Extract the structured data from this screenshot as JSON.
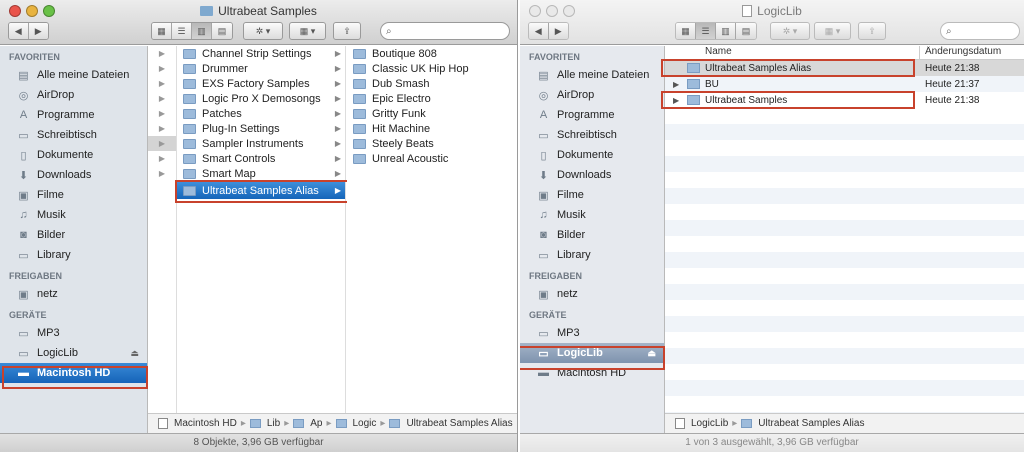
{
  "left": {
    "title": "Ultrabeat Samples",
    "search_placeholder": "",
    "sidebar": {
      "sections": [
        {
          "label": "FAVORITEN",
          "items": [
            {
              "label": "Alle meine Dateien",
              "icon": "all-files-icon"
            },
            {
              "label": "AirDrop",
              "icon": "airdrop-icon"
            },
            {
              "label": "Programme",
              "icon": "applications-icon"
            },
            {
              "label": "Schreibtisch",
              "icon": "desktop-icon"
            },
            {
              "label": "Dokumente",
              "icon": "documents-icon"
            },
            {
              "label": "Downloads",
              "icon": "downloads-icon"
            },
            {
              "label": "Filme",
              "icon": "movies-icon"
            },
            {
              "label": "Musik",
              "icon": "music-icon"
            },
            {
              "label": "Bilder",
              "icon": "pictures-icon"
            },
            {
              "label": "Library",
              "icon": "folder-icon"
            }
          ]
        },
        {
          "label": "FREIGABEN",
          "items": [
            {
              "label": "netz",
              "icon": "network-icon"
            }
          ]
        },
        {
          "label": "GERÄTE",
          "items": [
            {
              "label": "MP3",
              "icon": "disk-icon"
            },
            {
              "label": "LogicLib",
              "icon": "disk-icon"
            },
            {
              "label": "Macintosh HD",
              "icon": "hard-drive-icon"
            }
          ]
        }
      ]
    },
    "column2": [
      "Channel Strip Settings",
      "Drummer",
      "EXS Factory Samples",
      "Logic Pro X Demosongs",
      "Patches",
      "Plug-In Settings",
      "Sampler Instruments",
      "Smart Controls",
      "Smart Map",
      "Ultrabeat Samples Alias"
    ],
    "column3": [
      "Boutique 808",
      "Classic UK Hip Hop",
      "Dub Smash",
      "Epic Electro",
      "Gritty Funk",
      "Hit Machine",
      "Steely Beats",
      "Unreal Acoustic"
    ],
    "path": [
      "Macintosh HD",
      "Lib",
      "Ap",
      "Logic",
      "Ultrabeat Samples Alias"
    ],
    "status": "8 Objekte, 3,96 GB verfügbar"
  },
  "right": {
    "title": "LogicLib",
    "sidebar": {
      "sections": [
        {
          "label": "FAVORITEN",
          "items": [
            {
              "label": "Alle meine Dateien",
              "icon": "all-files-icon"
            },
            {
              "label": "AirDrop",
              "icon": "airdrop-icon"
            },
            {
              "label": "Programme",
              "icon": "applications-icon"
            },
            {
              "label": "Schreibtisch",
              "icon": "desktop-icon"
            },
            {
              "label": "Dokumente",
              "icon": "documents-icon"
            },
            {
              "label": "Downloads",
              "icon": "downloads-icon"
            },
            {
              "label": "Filme",
              "icon": "movies-icon"
            },
            {
              "label": "Musik",
              "icon": "music-icon"
            },
            {
              "label": "Bilder",
              "icon": "pictures-icon"
            },
            {
              "label": "Library",
              "icon": "folder-icon"
            }
          ]
        },
        {
          "label": "FREIGABEN",
          "items": [
            {
              "label": "netz",
              "icon": "network-icon"
            }
          ]
        },
        {
          "label": "GERÄTE",
          "items": [
            {
              "label": "MP3",
              "icon": "disk-icon"
            },
            {
              "label": "LogicLib",
              "icon": "disk-icon"
            },
            {
              "label": "Macintosh HD",
              "icon": "hard-drive-icon"
            }
          ]
        }
      ]
    },
    "list": {
      "columns": [
        "Name",
        "Änderungsdatum"
      ],
      "rows": [
        {
          "name": "Ultrabeat Samples Alias",
          "date": "Heute 21:38"
        },
        {
          "name": "BU",
          "date": "Heute 21:37"
        },
        {
          "name": "Ultrabeat Samples",
          "date": "Heute 21:38"
        }
      ]
    },
    "path": [
      "LogicLib",
      "Ultrabeat Samples Alias"
    ],
    "status": "1 von 3 ausgewählt, 3,96 GB verfügbar"
  },
  "colors": {
    "highlight": "#c8422c",
    "selection": "#1565b9"
  }
}
